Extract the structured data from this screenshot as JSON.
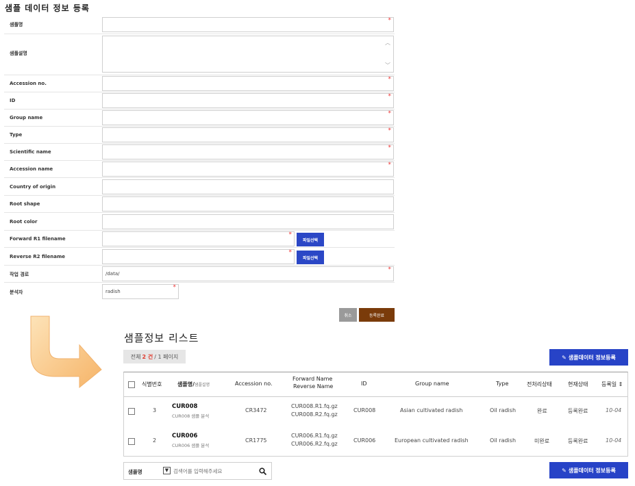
{
  "form": {
    "title": "샘플 데이터 정보 등록",
    "fields": {
      "sample_name": "샘플명",
      "sample_desc": "샘플설명",
      "accession_no": "Accession no.",
      "id": "ID",
      "group_name": "Group name",
      "type": "Type",
      "scientific_name": "Scientific name",
      "accession_name": "Accession name",
      "country": "Country of origin",
      "root_shape": "Root shape",
      "root_color": "Root color",
      "fwd": "Forward R1 filename",
      "rev": "Reverse R2 filename",
      "work_path": "작업 경로",
      "analyst": "분석자"
    },
    "values": {
      "work_path": "/data/",
      "analyst": "radish"
    },
    "required_mark": "*",
    "file_button": "파일선택",
    "cancel": "취소",
    "submit": "등록완료"
  },
  "list": {
    "title": "샘플정보 리스트",
    "count_prefix": "전체",
    "count_num": "2 건",
    "count_suffix": "/ 1 페이지",
    "register_button": "샘플데이터 정보등록",
    "headers": {
      "id_no": "식별번호",
      "name": "샘플명/",
      "name_sub": "샘플설명",
      "accession": "Accession no.",
      "fwd": "Forward Name",
      "rev": "Reverse Name",
      "id": "ID",
      "group": "Group name",
      "type": "Type",
      "pre": "전처리상태",
      "cur": "현재상태",
      "date": "등록일 ⇕"
    },
    "rows": [
      {
        "no": "3",
        "name": "CUR008",
        "desc": "CUR008 샘플 분석",
        "accession": "CR3472",
        "fwd": "CUR008.R1.fq.gz",
        "rev": "CUR008.R2.fq.gz",
        "id": "CUR008",
        "group": "Asian cultivated radish",
        "type": "Oil radish",
        "pre": "완료",
        "cur": "등록완료",
        "date": "10-04"
      },
      {
        "no": "2",
        "name": "CUR006",
        "desc": "CUR006 샘플 분석",
        "accession": "CR1775",
        "fwd": "CUR006.R1.fq.gz",
        "rev": "CUR006.R2.fq.gz",
        "id": "CUR006",
        "group": "European cultivated radish",
        "type": "Oil radish",
        "pre": "미완료",
        "cur": "등록완료",
        "date": "10-04"
      }
    ]
  },
  "search": {
    "select_value": "샘플명",
    "placeholder": "검색어를 입력해주세요"
  },
  "icons": {
    "pencil": "pencil-icon",
    "search": "search-icon",
    "arrow": "curved-arrow-icon"
  }
}
